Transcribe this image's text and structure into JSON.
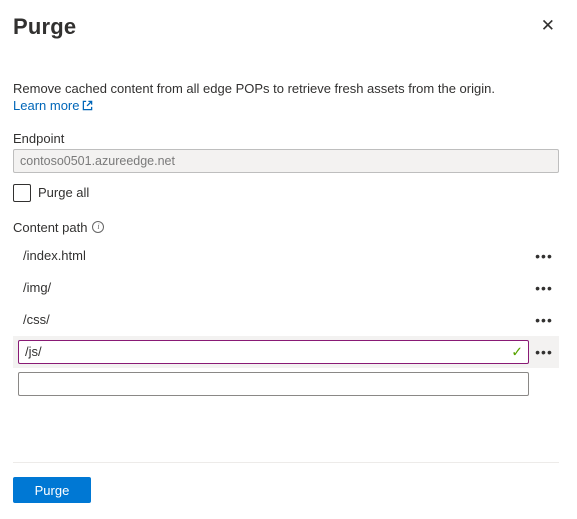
{
  "header": {
    "title": "Purge"
  },
  "description": "Remove cached content from all edge POPs to retrieve fresh assets from the origin.",
  "learnMore": "Learn more",
  "endpoint": {
    "label": "Endpoint",
    "value": "contoso0501.azureedge.net"
  },
  "purgeAll": {
    "label": "Purge all",
    "checked": false
  },
  "contentPath": {
    "label": "Content path",
    "items": [
      {
        "value": "/index.html",
        "mode": "static"
      },
      {
        "value": "/img/",
        "mode": "static"
      },
      {
        "value": "/css/",
        "mode": "static"
      },
      {
        "value": "/js/",
        "mode": "editing"
      }
    ],
    "newValue": ""
  },
  "footer": {
    "submit": "Purge"
  }
}
